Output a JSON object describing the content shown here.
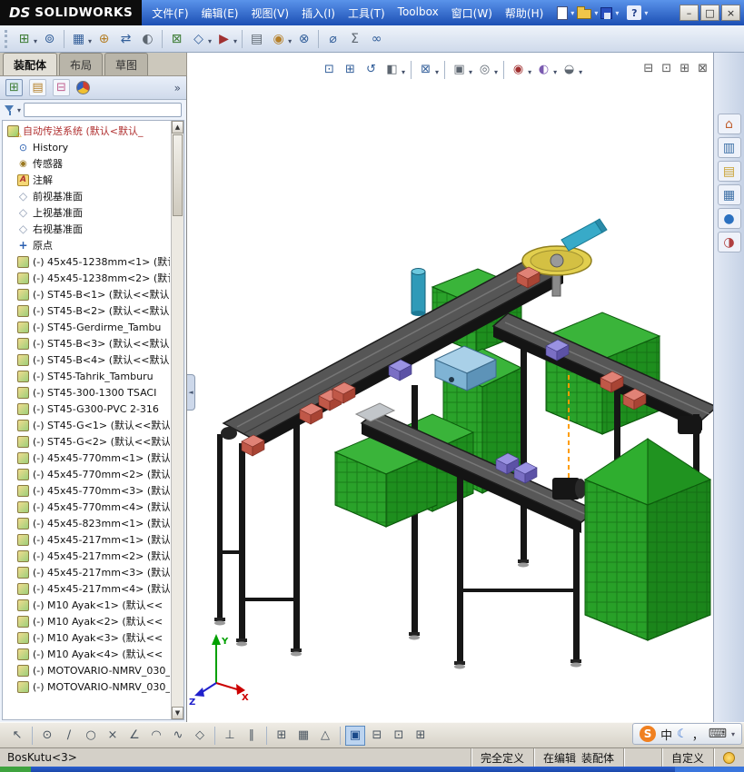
{
  "colors": {
    "titlebar_top": "#5a93ea",
    "titlebar_bottom": "#1c4fb4",
    "toolbar_bg": "#eef3fa",
    "panel_bg": "#edf2fa",
    "crate_green": "#2aa22a",
    "belt_gray": "#565656",
    "box_red": "#c05848",
    "box_purple": "#7a6fc4",
    "accent_blue": "#3a6ea5",
    "status_bg": "#d4d0c8",
    "taskbar_blue": "#2a5fd0",
    "ime_orange": "#f08020",
    "warn_red": "#b03030"
  },
  "title_bar": {
    "logo_prefix": "DS",
    "logo_text": "SOLIDWORKS",
    "menus": [
      "文件(F)",
      "编辑(E)",
      "视图(V)",
      "插入(I)",
      "工具(T)",
      "Toolbox",
      "窗口(W)",
      "帮助(H)"
    ],
    "help_glyph": "?",
    "minimize": "–",
    "maximize": "□",
    "close": "×"
  },
  "command_tabs": {
    "assembly": "装配体",
    "layout": "布局",
    "sketch": "草图"
  },
  "panel": {
    "chevron": "»",
    "collapse_glyph": "◄",
    "scroll_up": "▲",
    "scroll_down": "▼",
    "filter_value": ""
  },
  "tree": {
    "items": [
      {
        "t": "root",
        "label": "自动传送系统 (默认<默认_"
      },
      {
        "t": "hist",
        "label": "History"
      },
      {
        "t": "sens",
        "label": "传感器"
      },
      {
        "t": "ann",
        "label": "注解"
      },
      {
        "t": "plane",
        "label": "前视基准面"
      },
      {
        "t": "plane",
        "label": "上视基准面"
      },
      {
        "t": "plane",
        "label": "右视基准面"
      },
      {
        "t": "origin",
        "label": "原点"
      },
      {
        "t": "part",
        "label": "(-) 45x45-1238mm<1> (默认"
      },
      {
        "t": "part",
        "label": "(-) 45x45-1238mm<2> (默认"
      },
      {
        "t": "part",
        "label": "(-) ST45-B<1> (默认<<默认"
      },
      {
        "t": "part",
        "label": "(-) ST45-B<2> (默认<<默认"
      },
      {
        "t": "part",
        "label": "(-) ST45-Gerdirme_Tambu"
      },
      {
        "t": "part",
        "label": "(-) ST45-B<3> (默认<<默认"
      },
      {
        "t": "part",
        "label": "(-) ST45-B<4> (默认<<默认"
      },
      {
        "t": "part",
        "label": "(-) ST45-Tahrik_Tamburu"
      },
      {
        "t": "part",
        "label": "(-) ST45-300-1300 TSACI"
      },
      {
        "t": "part",
        "label": "(-) ST45-G300-PVC 2-316"
      },
      {
        "t": "part",
        "label": "(-) ST45-G<1> (默认<<默认"
      },
      {
        "t": "part",
        "label": "(-) ST45-G<2> (默认<<默认"
      },
      {
        "t": "part",
        "label": "(-) 45x45-770mm<1> (默认"
      },
      {
        "t": "part",
        "label": "(-) 45x45-770mm<2> (默认"
      },
      {
        "t": "part",
        "label": "(-) 45x45-770mm<3> (默认"
      },
      {
        "t": "part",
        "label": "(-) 45x45-770mm<4> (默认"
      },
      {
        "t": "part",
        "label": "(-) 45x45-823mm<1> (默认"
      },
      {
        "t": "part",
        "label": "(-) 45x45-217mm<1> (默认"
      },
      {
        "t": "part",
        "label": "(-) 45x45-217mm<2> (默认"
      },
      {
        "t": "part",
        "label": "(-) 45x45-217mm<3> (默认"
      },
      {
        "t": "part",
        "label": "(-) 45x45-217mm<4> (默认"
      },
      {
        "t": "part",
        "label": "(-) M10 Ayak<1> (默认<<"
      },
      {
        "t": "part",
        "label": "(-) M10 Ayak<2> (默认<<"
      },
      {
        "t": "part",
        "label": "(-) M10 Ayak<3> (默认<<"
      },
      {
        "t": "part",
        "label": "(-) M10 Ayak<4> (默认<<"
      },
      {
        "t": "part",
        "label": "(-) MOTOVARIO-NMRV_030_"
      },
      {
        "t": "part",
        "label": "(-) MOTOVARIO-NMRV_030_"
      }
    ]
  },
  "viewport": {
    "window_icons": [
      "⊟",
      "⊡",
      "⊞",
      "⊠"
    ],
    "triad": {
      "x": "X",
      "y": "Y",
      "z": "Z"
    }
  },
  "toolbar_icons": {
    "file": [
      {
        "n": "new-document"
      },
      {
        "n": "open-document"
      },
      {
        "n": "save"
      },
      {
        "n": "help",
        "g": "?"
      }
    ],
    "row2": [
      {
        "n": "insert-component",
        "g": "⊞"
      },
      {
        "n": "mate",
        "g": "⊚"
      },
      {
        "n": "linear-component-pattern",
        "g": "▦"
      },
      {
        "n": "smart-fasteners",
        "g": "⊕"
      },
      {
        "n": "move-component",
        "g": "⇄"
      },
      {
        "n": "show-hidden-components",
        "g": "◐"
      },
      {
        "n": "assembly-features",
        "g": "⊠"
      },
      {
        "n": "reference-geometry",
        "g": "◇"
      },
      {
        "n": "new-motion-study",
        "g": "▶"
      },
      {
        "n": "bill-of-materials",
        "g": "▤"
      },
      {
        "n": "exploded-view",
        "g": "◉"
      },
      {
        "n": "interference-detection",
        "g": "⊗"
      },
      {
        "n": "measure",
        "g": "⌀"
      },
      {
        "n": "mass-properties",
        "g": "Σ"
      },
      {
        "n": "simulation-advisor",
        "g": "∞"
      }
    ],
    "view": [
      {
        "n": "zoom-to-fit",
        "g": "⊡"
      },
      {
        "n": "zoom-to-area",
        "g": "⊞"
      },
      {
        "n": "previous-view",
        "g": "↺"
      },
      {
        "n": "section-view",
        "g": "◧"
      },
      {
        "n": "view-orientation",
        "g": "⊠"
      },
      {
        "n": "display-style",
        "g": "▣"
      },
      {
        "n": "hide-show-items",
        "g": "◎"
      },
      {
        "n": "edit-appearance",
        "g": "◉"
      },
      {
        "n": "apply-scene",
        "g": "◐"
      },
      {
        "n": "view-settings",
        "g": "◒"
      }
    ],
    "taskpane": [
      {
        "n": "home",
        "g": "⌂"
      },
      {
        "n": "solidworks-resources",
        "g": "▥"
      },
      {
        "n": "design-library",
        "g": "▤"
      },
      {
        "n": "file-explorer",
        "g": "▦"
      },
      {
        "n": "view-palette",
        "g": "●"
      },
      {
        "n": "appearances-scenes",
        "g": "◑"
      }
    ],
    "bottom": [
      {
        "n": "select",
        "g": "↖"
      },
      {
        "n": "sketch-point",
        "g": "⊙"
      },
      {
        "n": "sketch-line",
        "g": "∕"
      },
      {
        "n": "sketch-circle",
        "g": "○"
      },
      {
        "n": "sketch-erase",
        "g": "×"
      },
      {
        "n": "sketch-angle",
        "g": "∠"
      },
      {
        "n": "sketch-arc",
        "g": "◠"
      },
      {
        "n": "sketch-spline",
        "g": "∿"
      },
      {
        "n": "sketch-polygon",
        "g": "◇"
      },
      {
        "n": "constraint-perpendicular",
        "g": "⊥"
      },
      {
        "n": "constraint-parallel",
        "g": "∥"
      },
      {
        "n": "grid",
        "g": "⊞"
      },
      {
        "n": "snap",
        "g": "▦"
      },
      {
        "n": "shaded-sketch",
        "g": "△"
      },
      {
        "n": "view-single",
        "g": "▣"
      },
      {
        "n": "view-split-horizontal",
        "g": "⊟"
      },
      {
        "n": "view-split-vertical",
        "g": "⊡"
      },
      {
        "n": "view-four",
        "g": "⊞"
      }
    ],
    "panel_tabs": [
      {
        "n": "feature-manager",
        "g": "⊞"
      },
      {
        "n": "property-manager",
        "g": "▤"
      },
      {
        "n": "configuration-manager",
        "g": "⊟"
      },
      {
        "n": "display-manager",
        "g": ""
      }
    ]
  },
  "status_bar": {
    "left": "BosKutu<3>",
    "defined": "完全定义",
    "editing": "在编辑",
    "doc": "装配体",
    "custom": "自定义"
  },
  "ime": {
    "logo": "S",
    "lang": "中",
    "moon": "☾",
    "punct": "，",
    "keyboard": "⌨",
    "caret": "▾"
  }
}
